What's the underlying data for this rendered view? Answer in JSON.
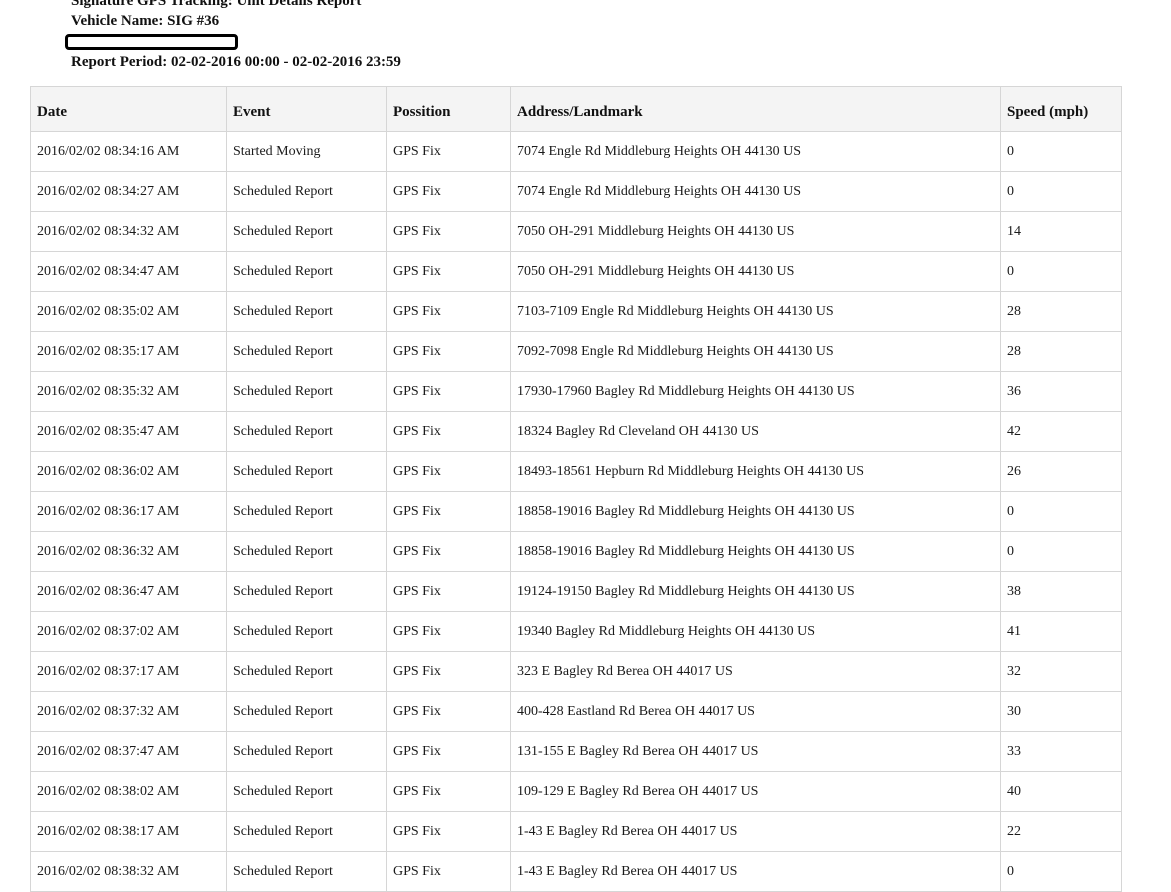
{
  "header": {
    "title": "Signature GPS Tracking: Unit Details Report",
    "vehicle": "Vehicle Name: SIG #36",
    "period": "Report Period: 02-02-2016 00:00 - 02-02-2016 23:59"
  },
  "table": {
    "columns": [
      "Date",
      "Event",
      "Possition",
      "Address/Landmark",
      "Speed (mph)"
    ],
    "rows": [
      [
        "2016/02/02 08:34:16 AM",
        "Started Moving",
        "GPS Fix",
        "7074 Engle Rd Middleburg Heights OH 44130 US",
        "0"
      ],
      [
        "2016/02/02 08:34:27 AM",
        "Scheduled Report",
        "GPS Fix",
        "7074 Engle Rd Middleburg Heights OH 44130 US",
        "0"
      ],
      [
        "2016/02/02 08:34:32 AM",
        "Scheduled Report",
        "GPS Fix",
        "7050 OH-291 Middleburg Heights OH 44130 US",
        "14"
      ],
      [
        "2016/02/02 08:34:47 AM",
        "Scheduled Report",
        "GPS Fix",
        "7050 OH-291 Middleburg Heights OH 44130 US",
        "0"
      ],
      [
        "2016/02/02 08:35:02 AM",
        "Scheduled Report",
        "GPS Fix",
        "7103-7109 Engle Rd Middleburg Heights OH 44130 US",
        "28"
      ],
      [
        "2016/02/02 08:35:17 AM",
        "Scheduled Report",
        "GPS Fix",
        "7092-7098 Engle Rd Middleburg Heights OH 44130 US",
        "28"
      ],
      [
        "2016/02/02 08:35:32 AM",
        "Scheduled Report",
        "GPS Fix",
        "17930-17960 Bagley Rd Middleburg Heights OH 44130 US",
        "36"
      ],
      [
        "2016/02/02 08:35:47 AM",
        "Scheduled Report",
        "GPS Fix",
        "18324 Bagley Rd Cleveland OH 44130 US",
        "42"
      ],
      [
        "2016/02/02 08:36:02 AM",
        "Scheduled Report",
        "GPS Fix",
        "18493-18561 Hepburn Rd Middleburg Heights OH 44130 US",
        "26"
      ],
      [
        "2016/02/02 08:36:17 AM",
        "Scheduled Report",
        "GPS Fix",
        "18858-19016 Bagley Rd Middleburg Heights OH 44130 US",
        "0"
      ],
      [
        "2016/02/02 08:36:32 AM",
        "Scheduled Report",
        "GPS Fix",
        "18858-19016 Bagley Rd Middleburg Heights OH 44130 US",
        "0"
      ],
      [
        "2016/02/02 08:36:47 AM",
        "Scheduled Report",
        "GPS Fix",
        "19124-19150 Bagley Rd Middleburg Heights OH 44130 US",
        "38"
      ],
      [
        "2016/02/02 08:37:02 AM",
        "Scheduled Report",
        "GPS Fix",
        "19340 Bagley Rd Middleburg Heights OH 44130 US",
        "41"
      ],
      [
        "2016/02/02 08:37:17 AM",
        "Scheduled Report",
        "GPS Fix",
        "323 E Bagley Rd Berea OH 44017 US",
        "32"
      ],
      [
        "2016/02/02 08:37:32 AM",
        "Scheduled Report",
        "GPS Fix",
        "400-428 Eastland Rd Berea OH 44017 US",
        "30"
      ],
      [
        "2016/02/02 08:37:47 AM",
        "Scheduled Report",
        "GPS Fix",
        "131-155 E Bagley Rd Berea OH 44017 US",
        "33"
      ],
      [
        "2016/02/02 08:38:02 AM",
        "Scheduled Report",
        "GPS Fix",
        "109-129 E Bagley Rd Berea OH 44017 US",
        "40"
      ],
      [
        "2016/02/02 08:38:17 AM",
        "Scheduled Report",
        "GPS Fix",
        "1-43 E Bagley Rd Berea OH 44017 US",
        "22"
      ],
      [
        "2016/02/02 08:38:32 AM",
        "Scheduled Report",
        "GPS Fix",
        "1-43 E Bagley Rd Berea OH 44017 US",
        "0"
      ]
    ]
  }
}
